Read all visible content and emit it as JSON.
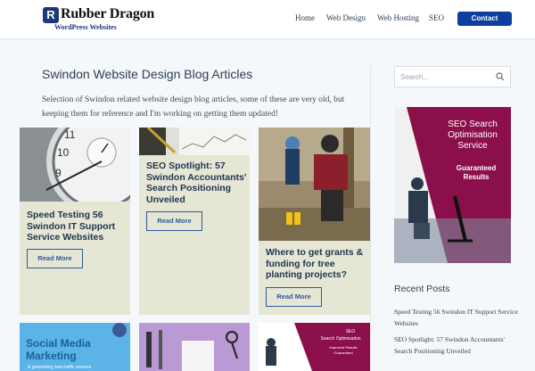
{
  "header": {
    "logo_title": "Rubber Dragon",
    "logo_sub": "WordPress Websites",
    "nav": [
      "Home",
      "Web Design",
      "Web Hosting",
      "SEO"
    ],
    "contact_label": "Contact"
  },
  "main": {
    "title": "Swindon Website Design Blog Articles",
    "intro": "Selection of Swindon related website design blog articles, some of these are very old, but keeping them for reference and I'm working on getting them updated!",
    "cards": [
      {
        "title": "Speed Testing 56 Swindon IT Support Service Websites",
        "button": "Read More"
      },
      {
        "title": "SEO Spotlight: 57 Swindon Accountants' Search Positioning Unveiled",
        "button": "Read More"
      },
      {
        "title": "Where to get grants & funding for tree planting projects?",
        "button": "Read More"
      }
    ],
    "bottom_cards": [
      {
        "image_text": [
          "Social Media",
          "Marketing",
          "& generating new traffic sources"
        ]
      },
      {
        "image_text": []
      },
      {
        "image_text": [
          "SEO",
          "Search Optimisation",
          "Improved Results",
          "Guaranteed"
        ]
      }
    ]
  },
  "sidebar": {
    "search_placeholder": "Search...",
    "ad_title": "SEO Search Optimisation Service",
    "ad_sub": "Guaranteed Results",
    "recent_heading": "Recent Posts",
    "recent_posts": [
      "Speed Testing 56 Swindon IT Support Service Websites",
      "SEO Spotlight: 57 Swindon Accountants' Search Positioning Unveiled"
    ]
  },
  "colors": {
    "accent": "#0d3f9f",
    "card_bg": "#e6e6d4",
    "ad_crimson": "#8b0f4a",
    "page_bg": "#f5f8fb"
  }
}
